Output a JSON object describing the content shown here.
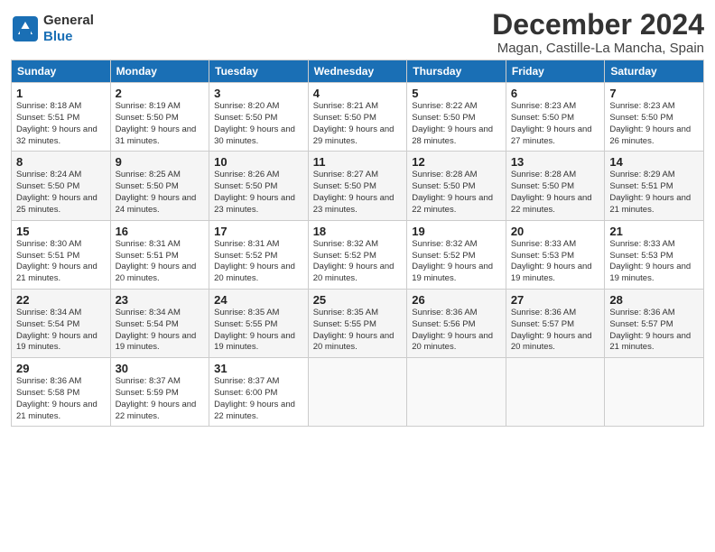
{
  "header": {
    "logo_general": "General",
    "logo_blue": "Blue",
    "title": "December 2024",
    "subtitle": "Magan, Castille-La Mancha, Spain"
  },
  "calendar": {
    "headers": [
      "Sunday",
      "Monday",
      "Tuesday",
      "Wednesday",
      "Thursday",
      "Friday",
      "Saturday"
    ],
    "weeks": [
      [
        {
          "day": "1",
          "info": "Sunrise: 8:18 AM\nSunset: 5:51 PM\nDaylight: 9 hours and 32 minutes."
        },
        {
          "day": "2",
          "info": "Sunrise: 8:19 AM\nSunset: 5:50 PM\nDaylight: 9 hours and 31 minutes."
        },
        {
          "day": "3",
          "info": "Sunrise: 8:20 AM\nSunset: 5:50 PM\nDaylight: 9 hours and 30 minutes."
        },
        {
          "day": "4",
          "info": "Sunrise: 8:21 AM\nSunset: 5:50 PM\nDaylight: 9 hours and 29 minutes."
        },
        {
          "day": "5",
          "info": "Sunrise: 8:22 AM\nSunset: 5:50 PM\nDaylight: 9 hours and 28 minutes."
        },
        {
          "day": "6",
          "info": "Sunrise: 8:23 AM\nSunset: 5:50 PM\nDaylight: 9 hours and 27 minutes."
        },
        {
          "day": "7",
          "info": "Sunrise: 8:23 AM\nSunset: 5:50 PM\nDaylight: 9 hours and 26 minutes."
        }
      ],
      [
        {
          "day": "8",
          "info": "Sunrise: 8:24 AM\nSunset: 5:50 PM\nDaylight: 9 hours and 25 minutes."
        },
        {
          "day": "9",
          "info": "Sunrise: 8:25 AM\nSunset: 5:50 PM\nDaylight: 9 hours and 24 minutes."
        },
        {
          "day": "10",
          "info": "Sunrise: 8:26 AM\nSunset: 5:50 PM\nDaylight: 9 hours and 23 minutes."
        },
        {
          "day": "11",
          "info": "Sunrise: 8:27 AM\nSunset: 5:50 PM\nDaylight: 9 hours and 23 minutes."
        },
        {
          "day": "12",
          "info": "Sunrise: 8:28 AM\nSunset: 5:50 PM\nDaylight: 9 hours and 22 minutes."
        },
        {
          "day": "13",
          "info": "Sunrise: 8:28 AM\nSunset: 5:50 PM\nDaylight: 9 hours and 22 minutes."
        },
        {
          "day": "14",
          "info": "Sunrise: 8:29 AM\nSunset: 5:51 PM\nDaylight: 9 hours and 21 minutes."
        }
      ],
      [
        {
          "day": "15",
          "info": "Sunrise: 8:30 AM\nSunset: 5:51 PM\nDaylight: 9 hours and 21 minutes."
        },
        {
          "day": "16",
          "info": "Sunrise: 8:31 AM\nSunset: 5:51 PM\nDaylight: 9 hours and 20 minutes."
        },
        {
          "day": "17",
          "info": "Sunrise: 8:31 AM\nSunset: 5:52 PM\nDaylight: 9 hours and 20 minutes."
        },
        {
          "day": "18",
          "info": "Sunrise: 8:32 AM\nSunset: 5:52 PM\nDaylight: 9 hours and 20 minutes."
        },
        {
          "day": "19",
          "info": "Sunrise: 8:32 AM\nSunset: 5:52 PM\nDaylight: 9 hours and 19 minutes."
        },
        {
          "day": "20",
          "info": "Sunrise: 8:33 AM\nSunset: 5:53 PM\nDaylight: 9 hours and 19 minutes."
        },
        {
          "day": "21",
          "info": "Sunrise: 8:33 AM\nSunset: 5:53 PM\nDaylight: 9 hours and 19 minutes."
        }
      ],
      [
        {
          "day": "22",
          "info": "Sunrise: 8:34 AM\nSunset: 5:54 PM\nDaylight: 9 hours and 19 minutes."
        },
        {
          "day": "23",
          "info": "Sunrise: 8:34 AM\nSunset: 5:54 PM\nDaylight: 9 hours and 19 minutes."
        },
        {
          "day": "24",
          "info": "Sunrise: 8:35 AM\nSunset: 5:55 PM\nDaylight: 9 hours and 19 minutes."
        },
        {
          "day": "25",
          "info": "Sunrise: 8:35 AM\nSunset: 5:55 PM\nDaylight: 9 hours and 20 minutes."
        },
        {
          "day": "26",
          "info": "Sunrise: 8:36 AM\nSunset: 5:56 PM\nDaylight: 9 hours and 20 minutes."
        },
        {
          "day": "27",
          "info": "Sunrise: 8:36 AM\nSunset: 5:57 PM\nDaylight: 9 hours and 20 minutes."
        },
        {
          "day": "28",
          "info": "Sunrise: 8:36 AM\nSunset: 5:57 PM\nDaylight: 9 hours and 21 minutes."
        }
      ],
      [
        {
          "day": "29",
          "info": "Sunrise: 8:36 AM\nSunset: 5:58 PM\nDaylight: 9 hours and 21 minutes."
        },
        {
          "day": "30",
          "info": "Sunrise: 8:37 AM\nSunset: 5:59 PM\nDaylight: 9 hours and 22 minutes."
        },
        {
          "day": "31",
          "info": "Sunrise: 8:37 AM\nSunset: 6:00 PM\nDaylight: 9 hours and 22 minutes."
        },
        {
          "day": "",
          "info": ""
        },
        {
          "day": "",
          "info": ""
        },
        {
          "day": "",
          "info": ""
        },
        {
          "day": "",
          "info": ""
        }
      ]
    ]
  }
}
